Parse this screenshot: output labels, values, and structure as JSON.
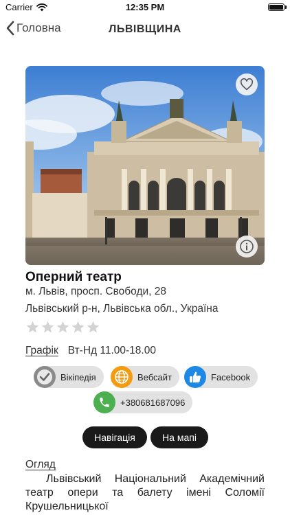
{
  "status_bar": {
    "carrier": "Carrier",
    "time": "12:35 PM"
  },
  "nav": {
    "back_label": "Головна",
    "title": "ЛЬВІВЩИНА"
  },
  "place": {
    "name": "Оперний театр",
    "address_line1": "м. Львів, просп. Свободи, 28",
    "address_line2": "Львівський р-н, Львівська обл., Україна",
    "rating": 0,
    "rating_max": 5
  },
  "schedule": {
    "label": "Графік",
    "value": "Вт-Нд 11.00-18.00"
  },
  "links": {
    "wikipedia": "Вікіпедія",
    "website": "Вебсайт",
    "facebook": "Facebook",
    "phone": "+380681687096"
  },
  "actions": {
    "navigation": "Навігація",
    "on_map": "На мапі"
  },
  "overview": {
    "label": "Огляд",
    "text": "Львівський Національний Академічний театр опери та балету імені Соломії Крушельницької"
  },
  "icons": {
    "back": "chevron-left-icon",
    "favorite": "heart-icon",
    "info": "info-icon",
    "wiki": "check-circle-icon",
    "web": "globe-icon",
    "facebook": "thumbs-up-icon",
    "phone": "phone-icon"
  },
  "colors": {
    "website_icon": "#f39c12",
    "facebook_icon": "#1e88e5",
    "phone_icon": "#4caf50",
    "wiki_icon": "#8a8a8a",
    "pill_bg": "#e2e2e2",
    "dark_button": "#1a1a1a",
    "star_empty": "#d3d3d3"
  }
}
